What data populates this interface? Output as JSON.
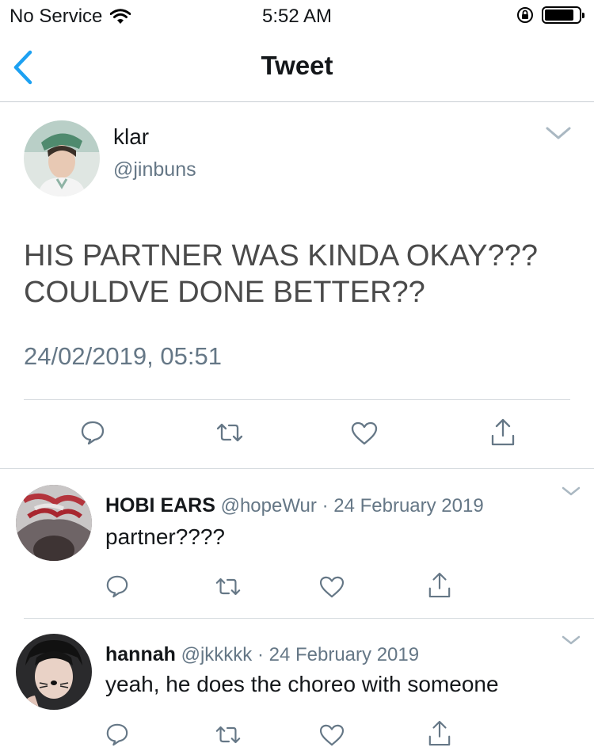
{
  "status_bar": {
    "carrier": "No Service",
    "time": "5:52 AM"
  },
  "nav": {
    "title": "Tweet"
  },
  "main_tweet": {
    "author_name": "klar",
    "author_handle": "@jinbuns",
    "text_line1": "HIS PARTNER WAS KINDA OKAY???",
    "text_line2": "COULDVE DONE BETTER??",
    "timestamp": "24/02/2019, 05:51"
  },
  "replies": [
    {
      "name": "HOBI EARS",
      "handle": "@hopeWur",
      "sep": "·",
      "date": "24 February 2019",
      "text": "partner????"
    },
    {
      "name": "hannah",
      "handle": "@jkkkkk",
      "sep": "·",
      "date": "24 February 2019",
      "text": "yeah, he does the choreo with someone"
    }
  ],
  "colors": {
    "accent": "#1da1f2",
    "icon_gray": "#657786",
    "divider": "#d6dbdf"
  }
}
